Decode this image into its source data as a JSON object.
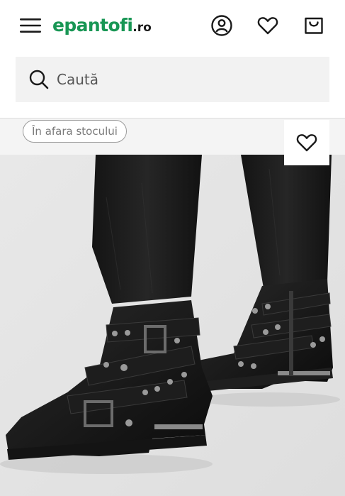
{
  "header": {
    "logo_main": "epantofi",
    "logo_tld": ".ro",
    "icons": [
      "menu-icon",
      "account-icon",
      "heart-icon",
      "cart-icon"
    ]
  },
  "search": {
    "placeholder": "Caută"
  },
  "product": {
    "stock_badge": "În afara stocului"
  },
  "colors": {
    "brand_green": "#189654",
    "text_dark": "#1a1a1a",
    "search_bg": "#f2f2f2",
    "badge_border": "#9a9a9a"
  }
}
